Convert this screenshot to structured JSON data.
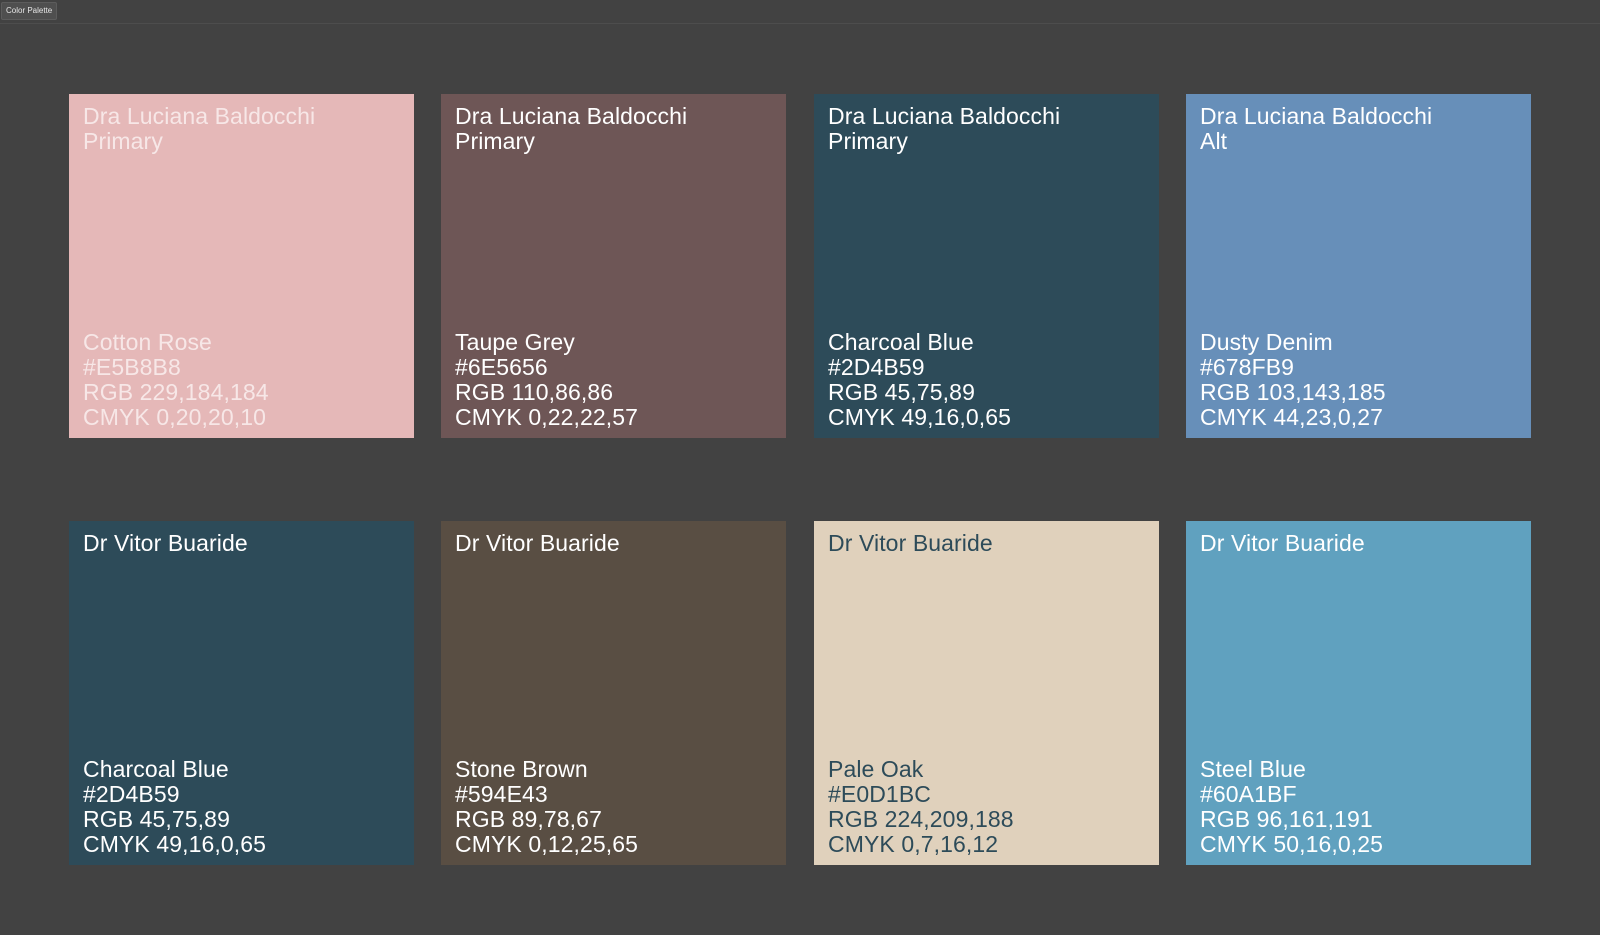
{
  "window": {
    "tab_label": "Color Palette"
  },
  "swatches": [
    {
      "owner": "Dra Luciana Baldocchi",
      "role": "Primary",
      "name": "Cotton Rose",
      "hex": "#E5B8B8",
      "rgb": "RGB 229,184,184",
      "cmyk": "CMYK 0,20,20,10",
      "color": "#E5B8B8",
      "text_color": "#F7E7E7"
    },
    {
      "owner": "Dra Luciana Baldocchi",
      "role": "Primary",
      "name": "Taupe Grey",
      "hex": "#6E5656",
      "rgb": "RGB 110,86,86",
      "cmyk": "CMYK 0,22,22,57",
      "color": "#6E5656",
      "text_color": "#FFFFFF"
    },
    {
      "owner": "Dra Luciana Baldocchi",
      "role": "Primary",
      "name": "Charcoal Blue",
      "hex": "#2D4B59",
      "rgb": "RGB 45,75,89",
      "cmyk": "CMYK 49,16,0,65",
      "color": "#2D4B59",
      "text_color": "#FFFFFF"
    },
    {
      "owner": "Dra Luciana Baldocchi",
      "role": "Alt",
      "name": "Dusty Denim",
      "hex": "#678FB9",
      "rgb": "RGB 103,143,185",
      "cmyk": "CMYK 44,23,0,27",
      "color": "#678FB9",
      "text_color": "#FFFFFF"
    },
    {
      "owner": "Dr Vitor Buaride",
      "role": "",
      "name": "Charcoal Blue",
      "hex": "#2D4B59",
      "rgb": "RGB 45,75,89",
      "cmyk": "CMYK 49,16,0,65",
      "color": "#2D4B59",
      "text_color": "#FFFFFF"
    },
    {
      "owner": "Dr Vitor Buaride",
      "role": "",
      "name": "Stone Brown",
      "hex": "#594E43",
      "rgb": "RGB 89,78,67",
      "cmyk": "CMYK 0,12,25,65",
      "color": "#594E43",
      "text_color": "#FFFFFF"
    },
    {
      "owner": "Dr Vitor Buaride",
      "role": "",
      "name": "Pale Oak",
      "hex": "#E0D1BC",
      "rgb": "RGB 224,209,188",
      "cmyk": "CMYK 0,7,16,12",
      "color": "#E0D1BC",
      "text_color": "#2D4B59"
    },
    {
      "owner": "Dr Vitor Buaride",
      "role": "",
      "name": "Steel Blue",
      "hex": "#60A1BF",
      "rgb": "RGB 96,161,191",
      "cmyk": "CMYK 50,16,0,25",
      "color": "#60A1BF",
      "text_color": "#FFFFFF"
    }
  ]
}
